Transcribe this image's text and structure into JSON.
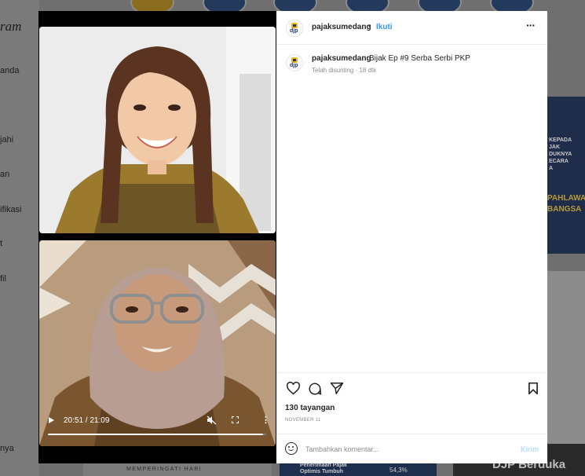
{
  "background": {
    "logo_fragment": "ram",
    "nav_fragments": [
      "anda",
      "jahi",
      "an",
      "ifikasi",
      "t",
      "fil",
      "nya"
    ],
    "right_card_lines": [
      "KEPADA",
      "JAK",
      "DUKNYA",
      "ECARA",
      "A"
    ],
    "right_card_big": [
      "PAHLAWA",
      "BANGSA"
    ],
    "bottom_left": "MEMPERINGATI HARI",
    "bottom_mid": "Penerimaan Pajak Optimis Tumbuh",
    "bottom_mid_pct": "54,3%",
    "bottom_right": "DJP Berduka"
  },
  "video": {
    "time": "20:51 / 21:09",
    "progress": 0.986,
    "mute_icon": "speaker-muted-icon",
    "fullscreen_icon": "fullscreen-icon",
    "more_icon": "more-vertical-icon"
  },
  "post": {
    "header": {
      "username": "pajaksumedang",
      "separator": "•",
      "follow": "Ikuti",
      "more": "···",
      "avatar_text": "djp"
    },
    "caption": {
      "username": "pajaksumedang",
      "text": "Bijak Ep #9 Serba Serbi PKP",
      "meta": "Telah disunting · 18 dtk"
    },
    "views": "130 tayangan",
    "date": "NOVEMBER 11",
    "comment": {
      "placeholder": "Tambahkan komentar...",
      "post_label": "Kirim"
    }
  },
  "colors": {
    "accent": "#3897f0",
    "post_disabled": "#b2dffc",
    "brand_yellow": "#f0b619",
    "brand_navy": "#1f3566"
  }
}
